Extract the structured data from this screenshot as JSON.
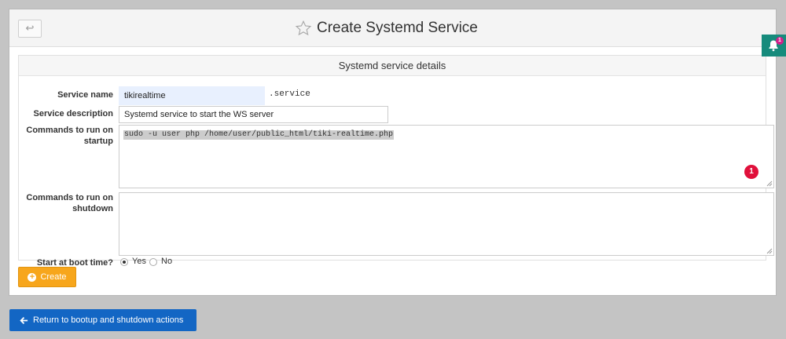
{
  "header": {
    "title": "Create Systemd Service",
    "back_symbol": "↩",
    "notification_count": "1"
  },
  "form": {
    "caption": "Systemd service details",
    "service_name": {
      "label": "Service name",
      "value": "tikirealtime",
      "suffix": ".service"
    },
    "service_description": {
      "label": "Service description",
      "value": "Systemd service to start the WS server"
    },
    "startup_commands": {
      "label_line1": "Commands to run on",
      "label_line2": "startup",
      "value": "sudo -u user php /home/user/public_html/tiki-realtime.php",
      "error_badge": "1"
    },
    "shutdown_commands": {
      "label_line1": "Commands to run on",
      "label_line2": "shutdown",
      "value": ""
    },
    "boot_time": {
      "label": "Start at boot time?",
      "options": [
        "Yes",
        "No"
      ],
      "selected": "Yes"
    }
  },
  "actions": {
    "create_label": "Create",
    "return_label": "Return to bootup and shutdown actions"
  },
  "colors": {
    "create": "#f7a61c",
    "return": "#1366c4",
    "notification_tab": "#168b7c",
    "error_badge": "#e0103b"
  }
}
